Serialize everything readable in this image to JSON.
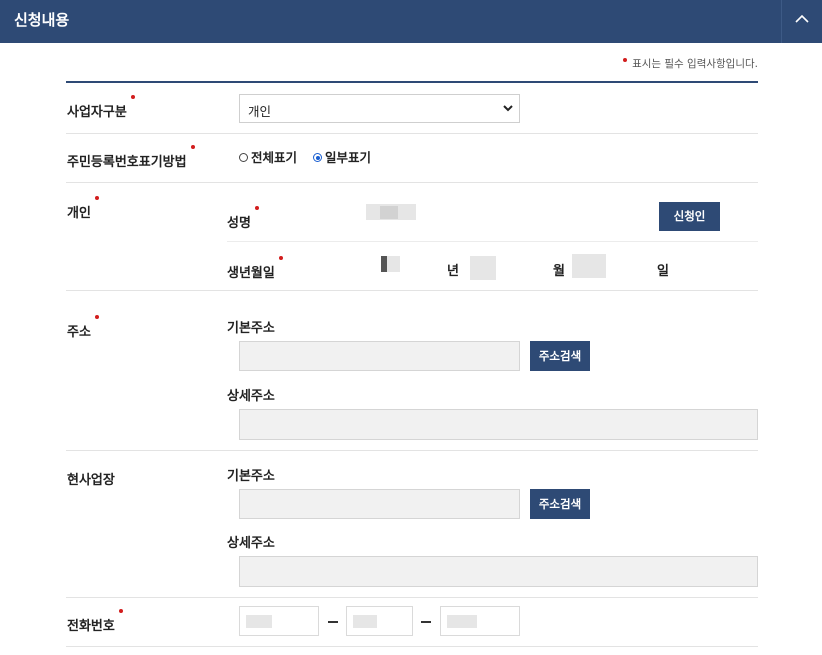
{
  "header": {
    "title": "신청내용",
    "collapse_icon": "chevron-up-icon"
  },
  "required_note": "표시는 필수 입력사항입니다.",
  "business_type": {
    "label": "사업자구분",
    "selected": "개인",
    "icon": "chevron-down-icon"
  },
  "rrn_display": {
    "label": "주민등록번호표기방법",
    "options": [
      {
        "label": "전체표기",
        "checked": false
      },
      {
        "label": "일부표기",
        "checked": true
      }
    ]
  },
  "individual": {
    "label": "개인",
    "name_label": "성명",
    "applicant_button": "신청인",
    "birth_label": "생년월일",
    "year_unit": "년",
    "month_unit": "월",
    "day_unit": "일"
  },
  "address": {
    "label": "주소",
    "basic_label": "기본주소",
    "search_button": "주소검색",
    "detail_label": "상세주소"
  },
  "workplace": {
    "label": "현사업장",
    "basic_label": "기본주소",
    "search_button": "주소검색",
    "detail_label": "상세주소"
  },
  "phone": {
    "label": "전화번호"
  },
  "colors": {
    "primary": "#2e4a75",
    "required": "#d21d1d"
  }
}
